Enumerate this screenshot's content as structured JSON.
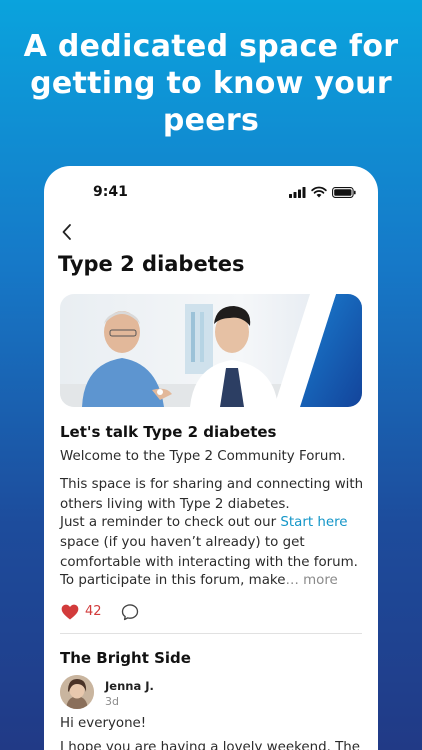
{
  "headline": "A dedicated space for getting to know your peers",
  "status_bar": {
    "time": "9:41"
  },
  "page": {
    "title": "Type 2 diabetes"
  },
  "post": {
    "title": "Let's talk Type 2 diabetes",
    "p1": "Welcome to the Type 2 Community Forum.",
    "p2": "This space is for sharing and connecting with others living with Type 2 diabetes.",
    "p3_before": "Just a reminder to check out our ",
    "p3_link": "Start here",
    "p3_after": " space (if you haven’t already) to get comfortable with interacting with the forum.",
    "p4": "To participate in this forum, make",
    "p4_ellipsis": "…",
    "more_label": "more",
    "like_count": "42"
  },
  "reply": {
    "section_title": "The Bright Side",
    "author": "Jenna J.",
    "age": "3d",
    "line1": "Hi everyone!",
    "line2": "I hope you are having a lovely weekend. The"
  },
  "colors": {
    "accent_link": "#1496c8",
    "like_red": "#d23b3b",
    "background_top": "#0aa3dd",
    "background_bottom": "#213a86"
  },
  "icons": [
    "chevron-left-icon",
    "heart-icon",
    "comment-bubble-icon",
    "signal-icon",
    "wifi-icon",
    "battery-icon"
  ]
}
